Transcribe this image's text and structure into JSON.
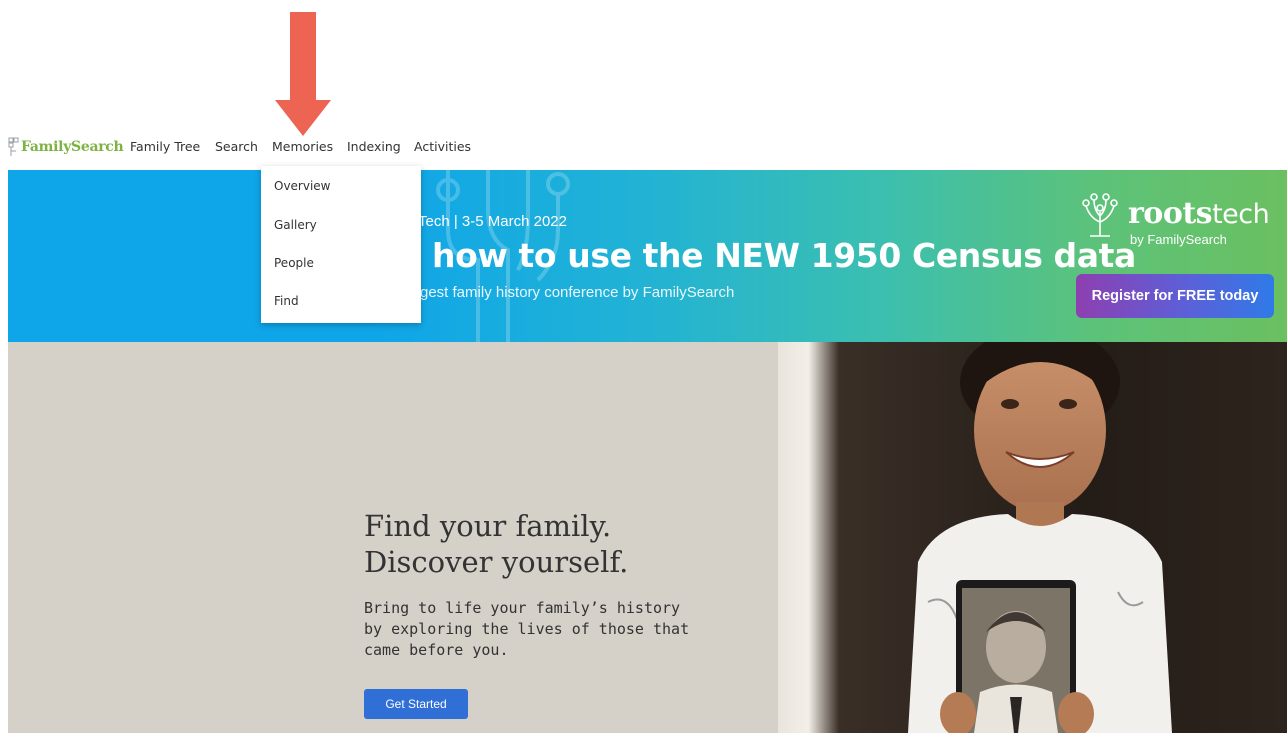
{
  "nav": {
    "logo_text": "FamilySearch",
    "items": [
      "Family Tree",
      "Search",
      "Memories",
      "Indexing",
      "Activities"
    ]
  },
  "memories_menu": {
    "items": [
      "Overview",
      "Gallery",
      "People",
      "Find"
    ]
  },
  "banner": {
    "kicker": "otsTech  |  3-5 March 2022",
    "headline": "how to use the NEW 1950 Census data",
    "subtext": "gest family history conference by FamilySearch",
    "brand_main": "roots",
    "brand_suffix": "tech",
    "brand_byline": "by FamilySearch",
    "register_label": "Register for FREE today"
  },
  "hero": {
    "title_line1": "Find your family.",
    "title_line2": "Discover yourself.",
    "description": "Bring to life your family’s history by exploring the lives of those that came before you.",
    "cta_label": "Get Started"
  },
  "colors": {
    "annotation_arrow": "#ee6453",
    "logo_green": "#7cb342",
    "banner_blue": "#0ea5e9",
    "banner_green": "#6bc060",
    "cta_blue": "#2f6fd6",
    "hero_bg": "#d5d0c8"
  },
  "icons": [
    "annotation-arrow-icon",
    "familysearch-tree-logo-icon",
    "rootstech-tree-logo-icon"
  ]
}
